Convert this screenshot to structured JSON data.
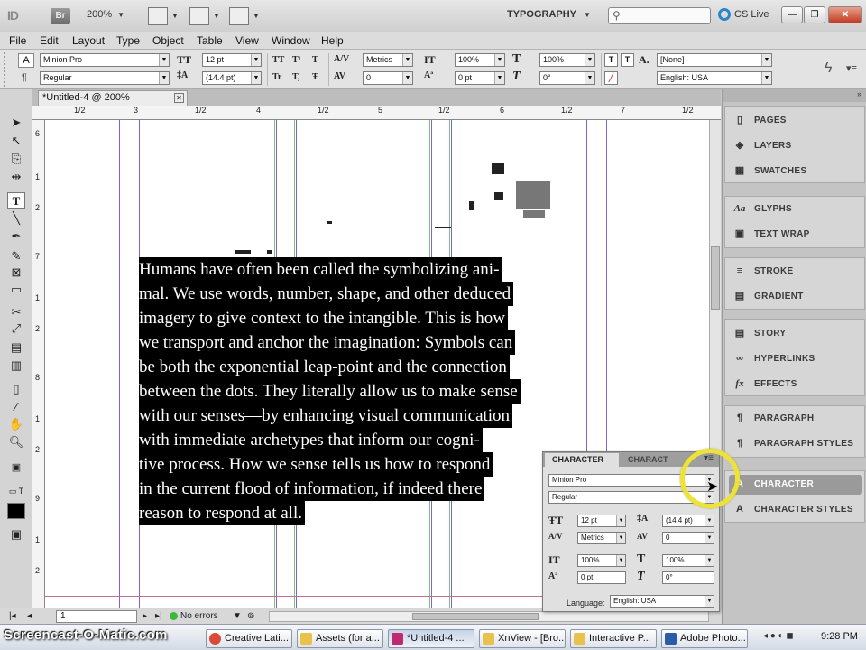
{
  "appbar": {
    "app_logo": "ID",
    "bridge_label": "Br",
    "zoom": "200%",
    "workspace": "TYPOGRAPHY",
    "search_placeholder": "",
    "cs_live": "CS Live"
  },
  "menu": {
    "items": [
      "File",
      "Edit",
      "Layout",
      "Type",
      "Object",
      "Table",
      "View",
      "Window",
      "Help"
    ]
  },
  "control_panel": {
    "font_family": "Minion Pro",
    "font_style": "Regular",
    "font_size": "12 pt",
    "leading": "(14.4 pt)",
    "kerning": "Metrics",
    "tracking": "0",
    "vertical_scale": "100%",
    "horizontal_scale": "100%",
    "baseline_shift": "0 pt",
    "skew": "0°",
    "char_style": "[None]",
    "language": "English: USA",
    "caps_labels": [
      "TT",
      "T¹",
      "T",
      "Tr",
      "T,",
      "Ŧ"
    ]
  },
  "document": {
    "tab_title": "*Untitled-4 @ 200%",
    "ruler_labels": [
      "1/2",
      "3",
      "1/2",
      "4",
      "1/2",
      "5",
      "1/2",
      "6",
      "1/2",
      "7",
      "1/2"
    ],
    "vruler_labels": [
      "6",
      "1",
      "2",
      "7",
      "1",
      "2",
      "8",
      "1",
      "2",
      "9",
      "1",
      "2"
    ],
    "text_lines": [
      "Humans have often been called the symbolizing ani-",
      "mal. We use words, number, shape, and other deduced",
      "imagery to give context to the intangible. This is how",
      "we transport and anchor the imagination: Symbols can",
      "be both the exponential leap-point and the connection",
      "between the dots. They literally allow us to make sense",
      "with our senses—by enhancing visual communication",
      "with immediate archetypes that inform our cogni-",
      "tive process. How we sense tells us how to respond",
      "in the current flood of information, if indeed there",
      "reason to respond at all."
    ]
  },
  "statusbar": {
    "page": "1",
    "preflight": "No errors"
  },
  "dock": {
    "groups": [
      [
        {
          "icon": "pages-icon",
          "glyph": "▯",
          "label": "PAGES"
        },
        {
          "icon": "layers-icon",
          "glyph": "◈",
          "label": "LAYERS"
        },
        {
          "icon": "swatches-icon",
          "glyph": "▦",
          "label": "SWATCHES"
        }
      ],
      [
        {
          "icon": "glyphs-icon",
          "glyph": "Aa",
          "label": "GLYPHS"
        },
        {
          "icon": "text-wrap-icon",
          "glyph": "▣",
          "label": "TEXT WRAP"
        }
      ],
      [
        {
          "icon": "stroke-icon",
          "glyph": "≡",
          "label": "STROKE"
        },
        {
          "icon": "gradient-icon",
          "glyph": "▤",
          "label": "GRADIENT"
        }
      ],
      [
        {
          "icon": "story-icon",
          "glyph": "▤",
          "label": "STORY"
        },
        {
          "icon": "hyperlinks-icon",
          "glyph": "∞",
          "label": "HYPERLINKS"
        },
        {
          "icon": "effects-icon",
          "glyph": "fx",
          "label": "EFFECTS"
        }
      ],
      [
        {
          "icon": "paragraph-icon",
          "glyph": "¶",
          "label": "PARAGRAPH"
        },
        {
          "icon": "paragraph-styles-icon",
          "glyph": "¶",
          "label": "PARAGRAPH STYLES"
        }
      ],
      [
        {
          "icon": "character-icon",
          "glyph": "A",
          "label": "CHARACTER"
        },
        {
          "icon": "character-styles-icon",
          "glyph": "A",
          "label": "CHARACTER STYLES"
        }
      ]
    ]
  },
  "char_panel": {
    "tab_active": "CHARACTER",
    "tab_inactive": "CHARACT",
    "font_family": "Minion Pro",
    "font_style": "Regular",
    "font_size": "12 pt",
    "leading": "(14.4 pt)",
    "kerning": "Metrics",
    "tracking": "0",
    "vertical_scale": "100%",
    "horizontal_scale": "100%",
    "baseline_shift": "0 pt",
    "skew": "0°",
    "language_label": "Language:",
    "language": "English: USA"
  },
  "taskbar": {
    "watermark": "Screencast-O-Matic.com",
    "buttons": [
      {
        "label": "Creative Lati...",
        "color": "#d94a38",
        "active": false
      },
      {
        "label": "Assets (for a...",
        "color": "#e8c24a",
        "active": false
      },
      {
        "label": "*Untitled-4 ...",
        "color": "#c02870",
        "active": true
      },
      {
        "label": "XnView - [Bro...",
        "color": "#e8c24a",
        "active": false
      },
      {
        "label": "Interactive P...",
        "color": "#e8c24a",
        "active": false
      },
      {
        "label": "Adobe Photo...",
        "color": "#2a5ca8",
        "active": false
      }
    ],
    "time": "9:28 PM"
  }
}
